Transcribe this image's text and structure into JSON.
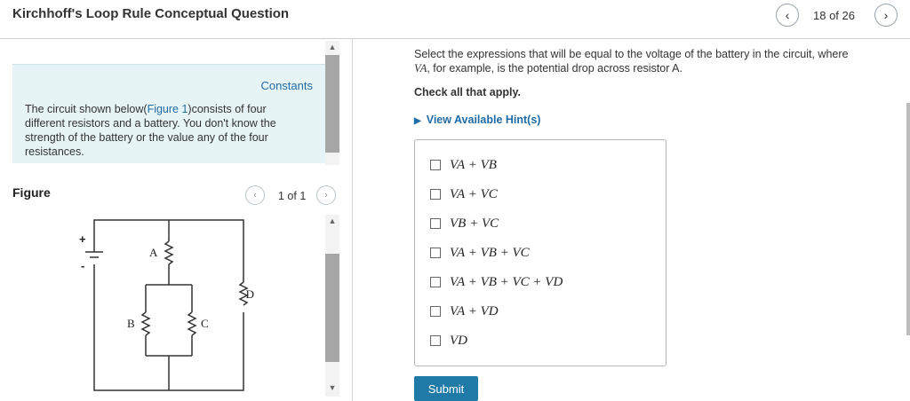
{
  "header": {
    "title": "Kirchhoff's Loop Rule Conceptual Question",
    "pager": "18 of 26",
    "prev_icon": "chevron-left-icon",
    "next_icon": "chevron-right-icon"
  },
  "left": {
    "constants_link": "Constants",
    "problem_text_before": "The circuit shown below(",
    "problem_link": "Figure 1",
    "problem_text_after": ")consists of four different resistors and a battery. You don't know the strength of the battery or the value any of the four resistances.",
    "figure_label": "Figure",
    "figure_count": "1 of 1",
    "circuit_labels": {
      "plus": "+",
      "minus": "-",
      "A": "A",
      "B": "B",
      "C": "C",
      "D": "D"
    }
  },
  "right": {
    "question_line1": "Select the expressions that will be equal to the voltage of the battery in the circuit, where",
    "question_var": "VA",
    "question_line2": ", for example, is the potential drop across resistor A.",
    "check_all": "Check all that apply.",
    "hint": "View Available Hint(s)",
    "options": [
      "VA + VB",
      "VA + VC",
      "VB + VC",
      "VA + VB + VC",
      "VA + VB + VC + VD",
      "VA + VD",
      "VD"
    ],
    "submit": "Submit"
  }
}
